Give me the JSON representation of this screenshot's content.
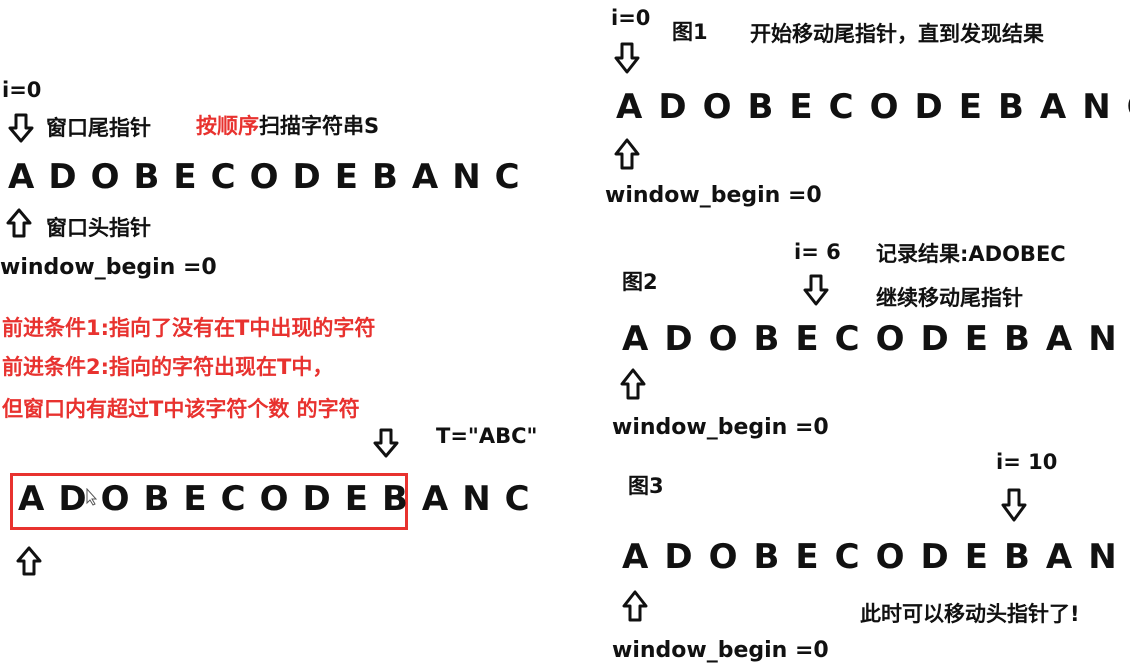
{
  "colors": {
    "text": "#111111",
    "red": "#e8322f",
    "background": "#ffffff"
  },
  "letters": [
    "A",
    "D",
    "O",
    "B",
    "E",
    "C",
    "O",
    "D",
    "E",
    "B",
    "A",
    "N",
    "C"
  ],
  "left": {
    "i_label": "i=0",
    "tail_pointer": "窗口尾指针",
    "scan_red": "按顺序",
    "scan_rest": "扫描字符串S",
    "head_pointer": "窗口头指针",
    "window_begin": "window_begin =0",
    "cond1": "前进条件1:指向了没有在T中出现的字符",
    "cond2": "前进条件2:指向的字符出现在T中，",
    "cond3": "但窗口内有超过T中该字符个数 的字符",
    "t_value": "T=\"ABC\""
  },
  "fig1": {
    "i_label": "i=0",
    "title": "图1",
    "note": "开始移动尾指针，直到发现结果",
    "window_begin": "window_begin =0"
  },
  "fig2": {
    "title": "图2",
    "i_label": "i= 6",
    "note1": "记录结果:ADOBEC",
    "note2": "继续移动尾指针",
    "window_begin": "window_begin =0"
  },
  "fig3": {
    "title": "图3",
    "i_label": "i= 10",
    "note": "此时可以移动头指针了!",
    "window_begin": "window_begin =0"
  }
}
